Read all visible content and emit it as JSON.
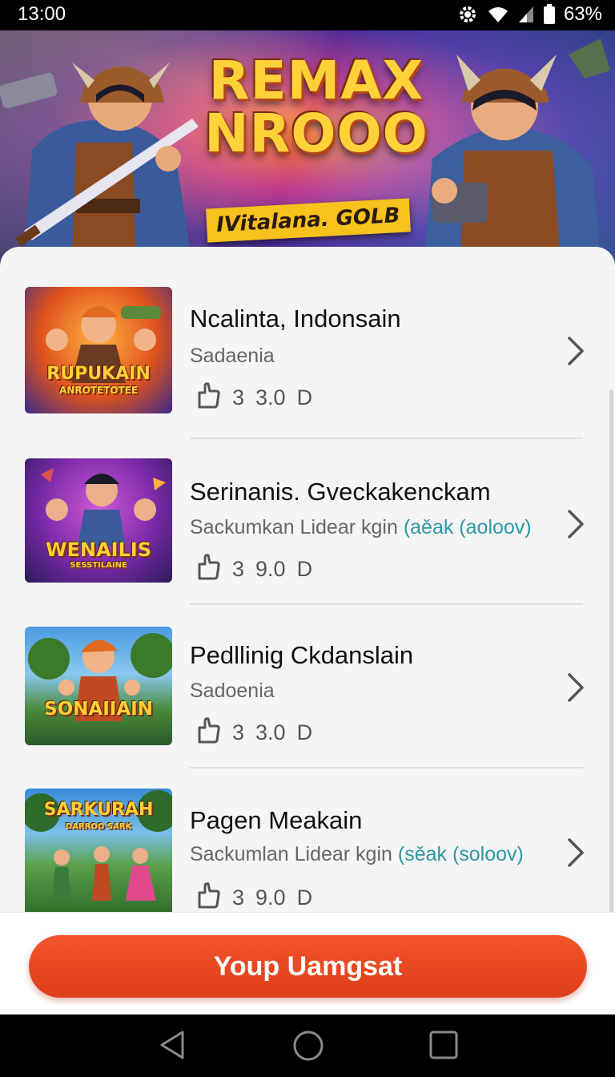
{
  "status_bar": {
    "time": "13:00",
    "battery": "63%",
    "icons": [
      "settings-gear-icon",
      "wifi-icon",
      "signal-icon",
      "battery-icon"
    ]
  },
  "hero": {
    "title_line1": "REMAX",
    "title_line2": "NROOO",
    "tagline": "IVitalana. GOLB"
  },
  "list": [
    {
      "title": "Ncalinta, Indonsain",
      "subtitle": "Sadaenia",
      "subtitle_accent": "",
      "meta_count": "3",
      "meta_value": "3.0",
      "meta_unit": "D",
      "thumb_text": "RUPUKAIN",
      "thumb_subtext": "ANROTETOTEE"
    },
    {
      "title": "Serinanis. Gveckakenckam",
      "subtitle": "Sackumkan Lidear kgin",
      "subtitle_accent": "(aěak (aoloov)",
      "meta_count": "3",
      "meta_value": "9.0",
      "meta_unit": "D",
      "thumb_text": "WENAILIS",
      "thumb_subtext": "SESSTILAINE"
    },
    {
      "title": "Pedllinig Ckdanslain",
      "subtitle": "Sadoenia",
      "subtitle_accent": "",
      "meta_count": "3",
      "meta_value": "3.0",
      "meta_unit": "D",
      "thumb_text": "SONAIIAIN",
      "thumb_subtext": ""
    },
    {
      "title": "Pagen Meakain",
      "subtitle": "Sackumlan Lidear kgin",
      "subtitle_accent": "(sěak (soloov)",
      "meta_count": "3",
      "meta_value": "9.0",
      "meta_unit": "D",
      "thumb_text": "SARKURAH",
      "thumb_subtext": "DARROO SARK"
    }
  ],
  "cta": {
    "label": "Youp Uamgsat"
  },
  "colors": {
    "accent": "#e84a22",
    "subtitle_accent": "#2a98a8"
  },
  "nav": {
    "icons": [
      "back-icon",
      "home-icon",
      "recents-icon"
    ]
  }
}
